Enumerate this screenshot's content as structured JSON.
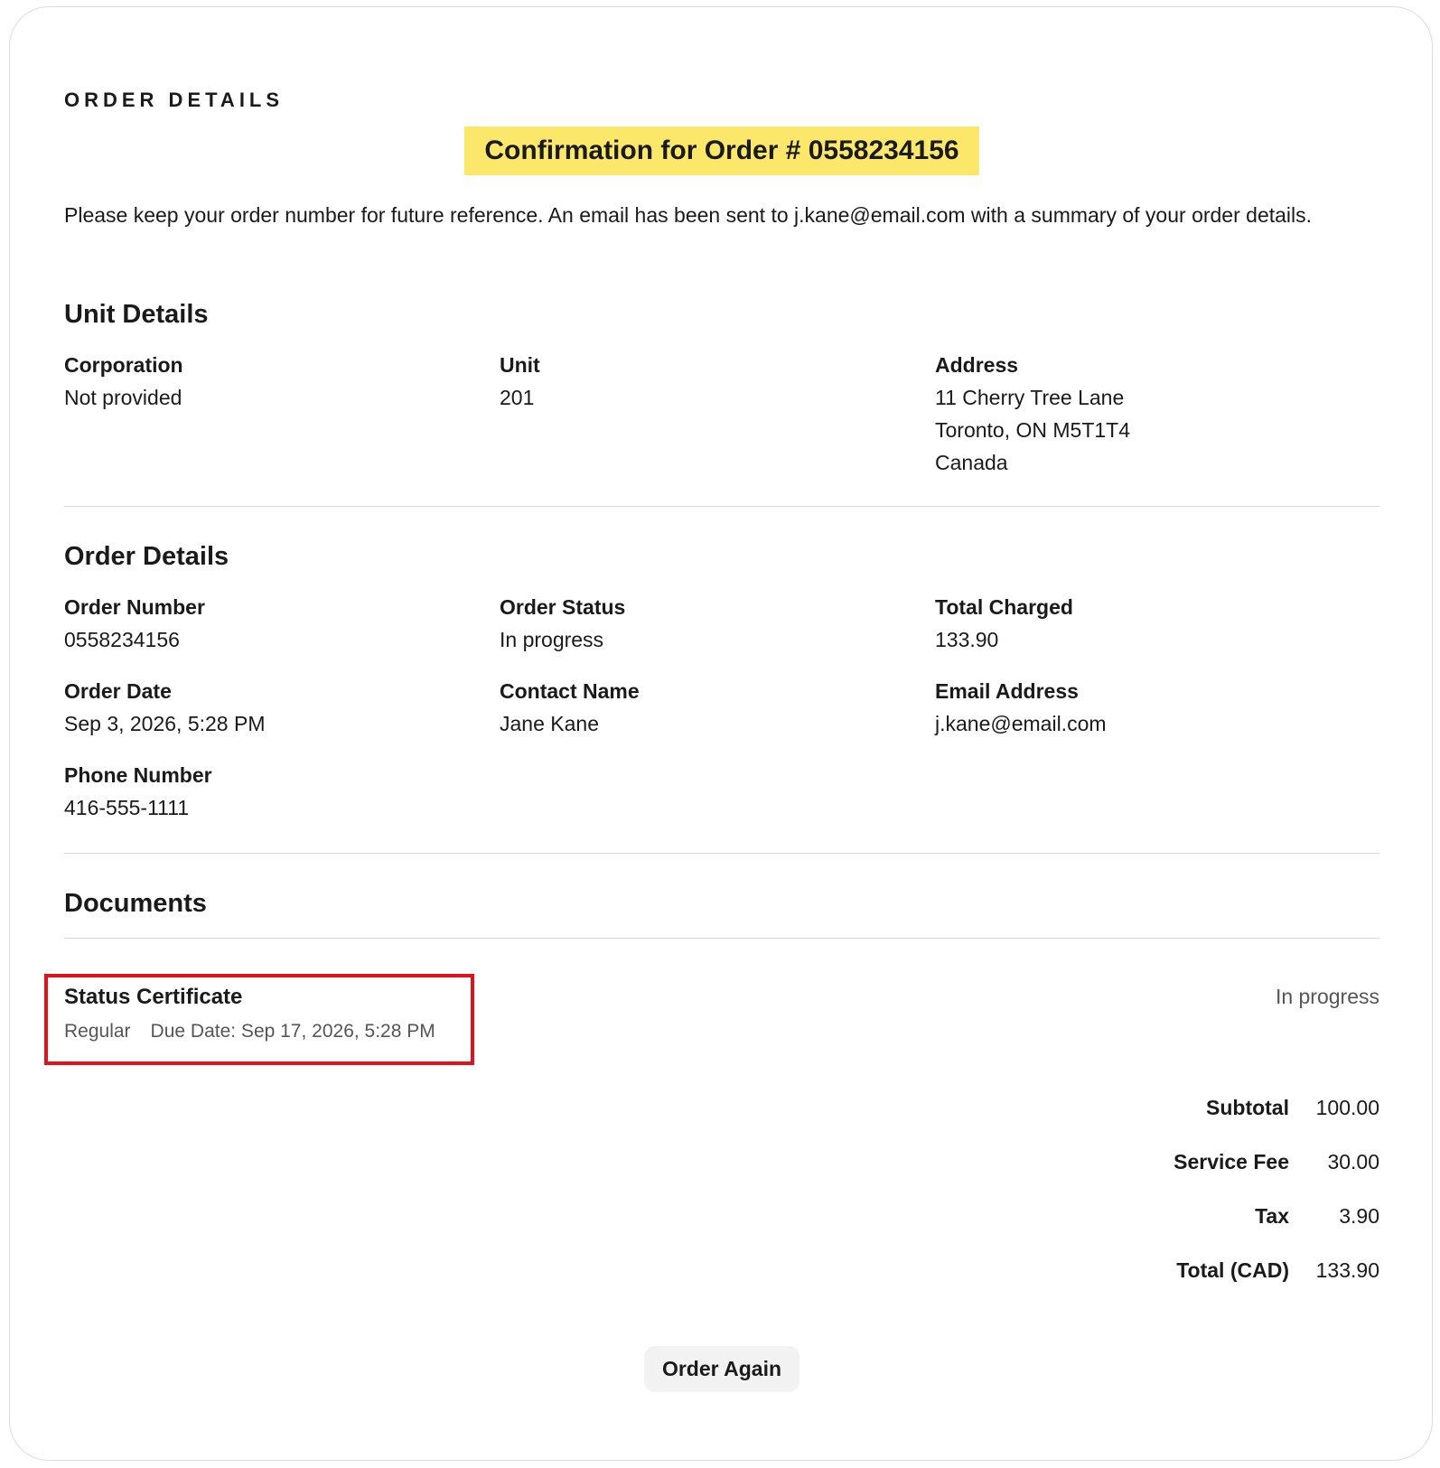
{
  "header": {
    "kicker": "ORDER DETAILS",
    "banner": "Confirmation for Order # 0558234156",
    "intro": "Please keep your order number for future reference. An email has been sent to j.kane@email.com with a summary of your order details."
  },
  "unit_details": {
    "title": "Unit Details",
    "corporation_label": "Corporation",
    "corporation_value": "Not provided",
    "unit_label": "Unit",
    "unit_value": "201",
    "address_label": "Address",
    "address_line1": "11 Cherry Tree Lane",
    "address_line2": "Toronto, ON M5T1T4",
    "address_line3": "Canada"
  },
  "order_details": {
    "title": "Order Details",
    "order_number_label": "Order Number",
    "order_number_value": "0558234156",
    "order_status_label": "Order Status",
    "order_status_value": "In progress",
    "total_charged_label": "Total Charged",
    "total_charged_value": "133.90",
    "order_date_label": "Order Date",
    "order_date_value": "Sep 3, 2026, 5:28 PM",
    "contact_name_label": "Contact Name",
    "contact_name_value": "Jane Kane",
    "email_label": "Email Address",
    "email_value": "j.kane@email.com",
    "phone_label": "Phone Number",
    "phone_value": "416-555-1111"
  },
  "documents": {
    "title": "Documents",
    "items": [
      {
        "name": "Status Certificate",
        "type": "Regular",
        "due": "Due Date: Sep 17, 2026, 5:28 PM",
        "status": "In progress"
      }
    ]
  },
  "totals": {
    "subtotal_label": "Subtotal",
    "subtotal_value": "100.00",
    "service_fee_label": "Service Fee",
    "service_fee_value": "30.00",
    "tax_label": "Tax",
    "tax_value": "3.90",
    "total_label": "Total (CAD)",
    "total_value": "133.90"
  },
  "actions": {
    "order_again": "Order Again"
  },
  "colors": {
    "banner_bg": "#fbe86a",
    "highlight_border": "#e0121b"
  }
}
